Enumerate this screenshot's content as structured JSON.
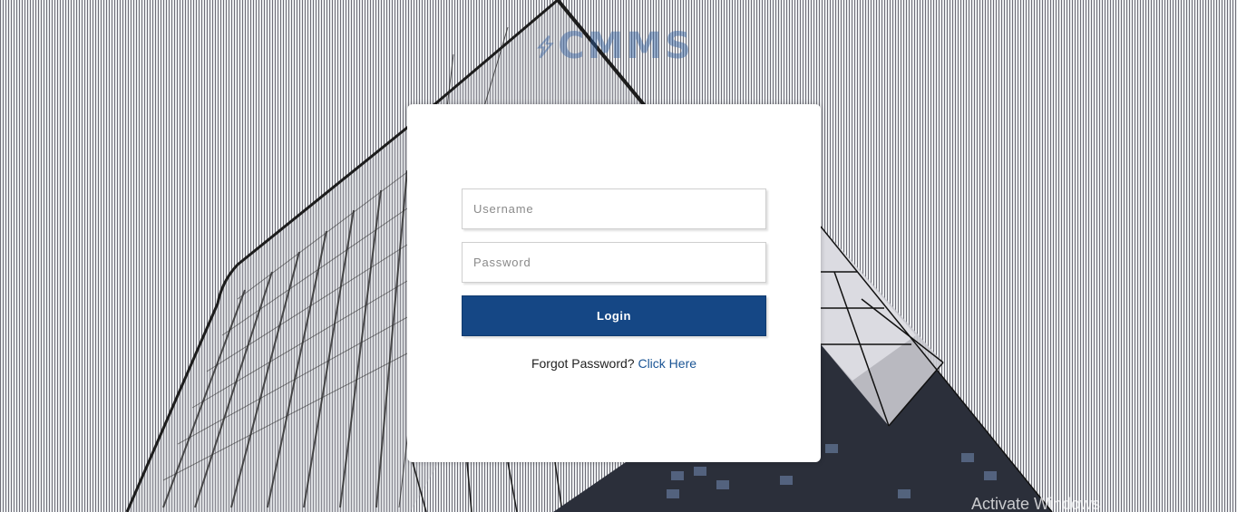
{
  "brand": {
    "name": "CMMS",
    "logo_icon": "brand-mark-icon"
  },
  "login_form": {
    "username_placeholder": "Username",
    "username_value": "",
    "password_placeholder": "Password",
    "password_value": "",
    "login_label": "Login",
    "forgot_text": "Forgot Password?",
    "forgot_link": "Click Here"
  },
  "os_watermark": {
    "text": "Activate Windows"
  },
  "colors": {
    "accent": "#154785",
    "link": "#1a5494",
    "card_background": "#ffffff"
  }
}
